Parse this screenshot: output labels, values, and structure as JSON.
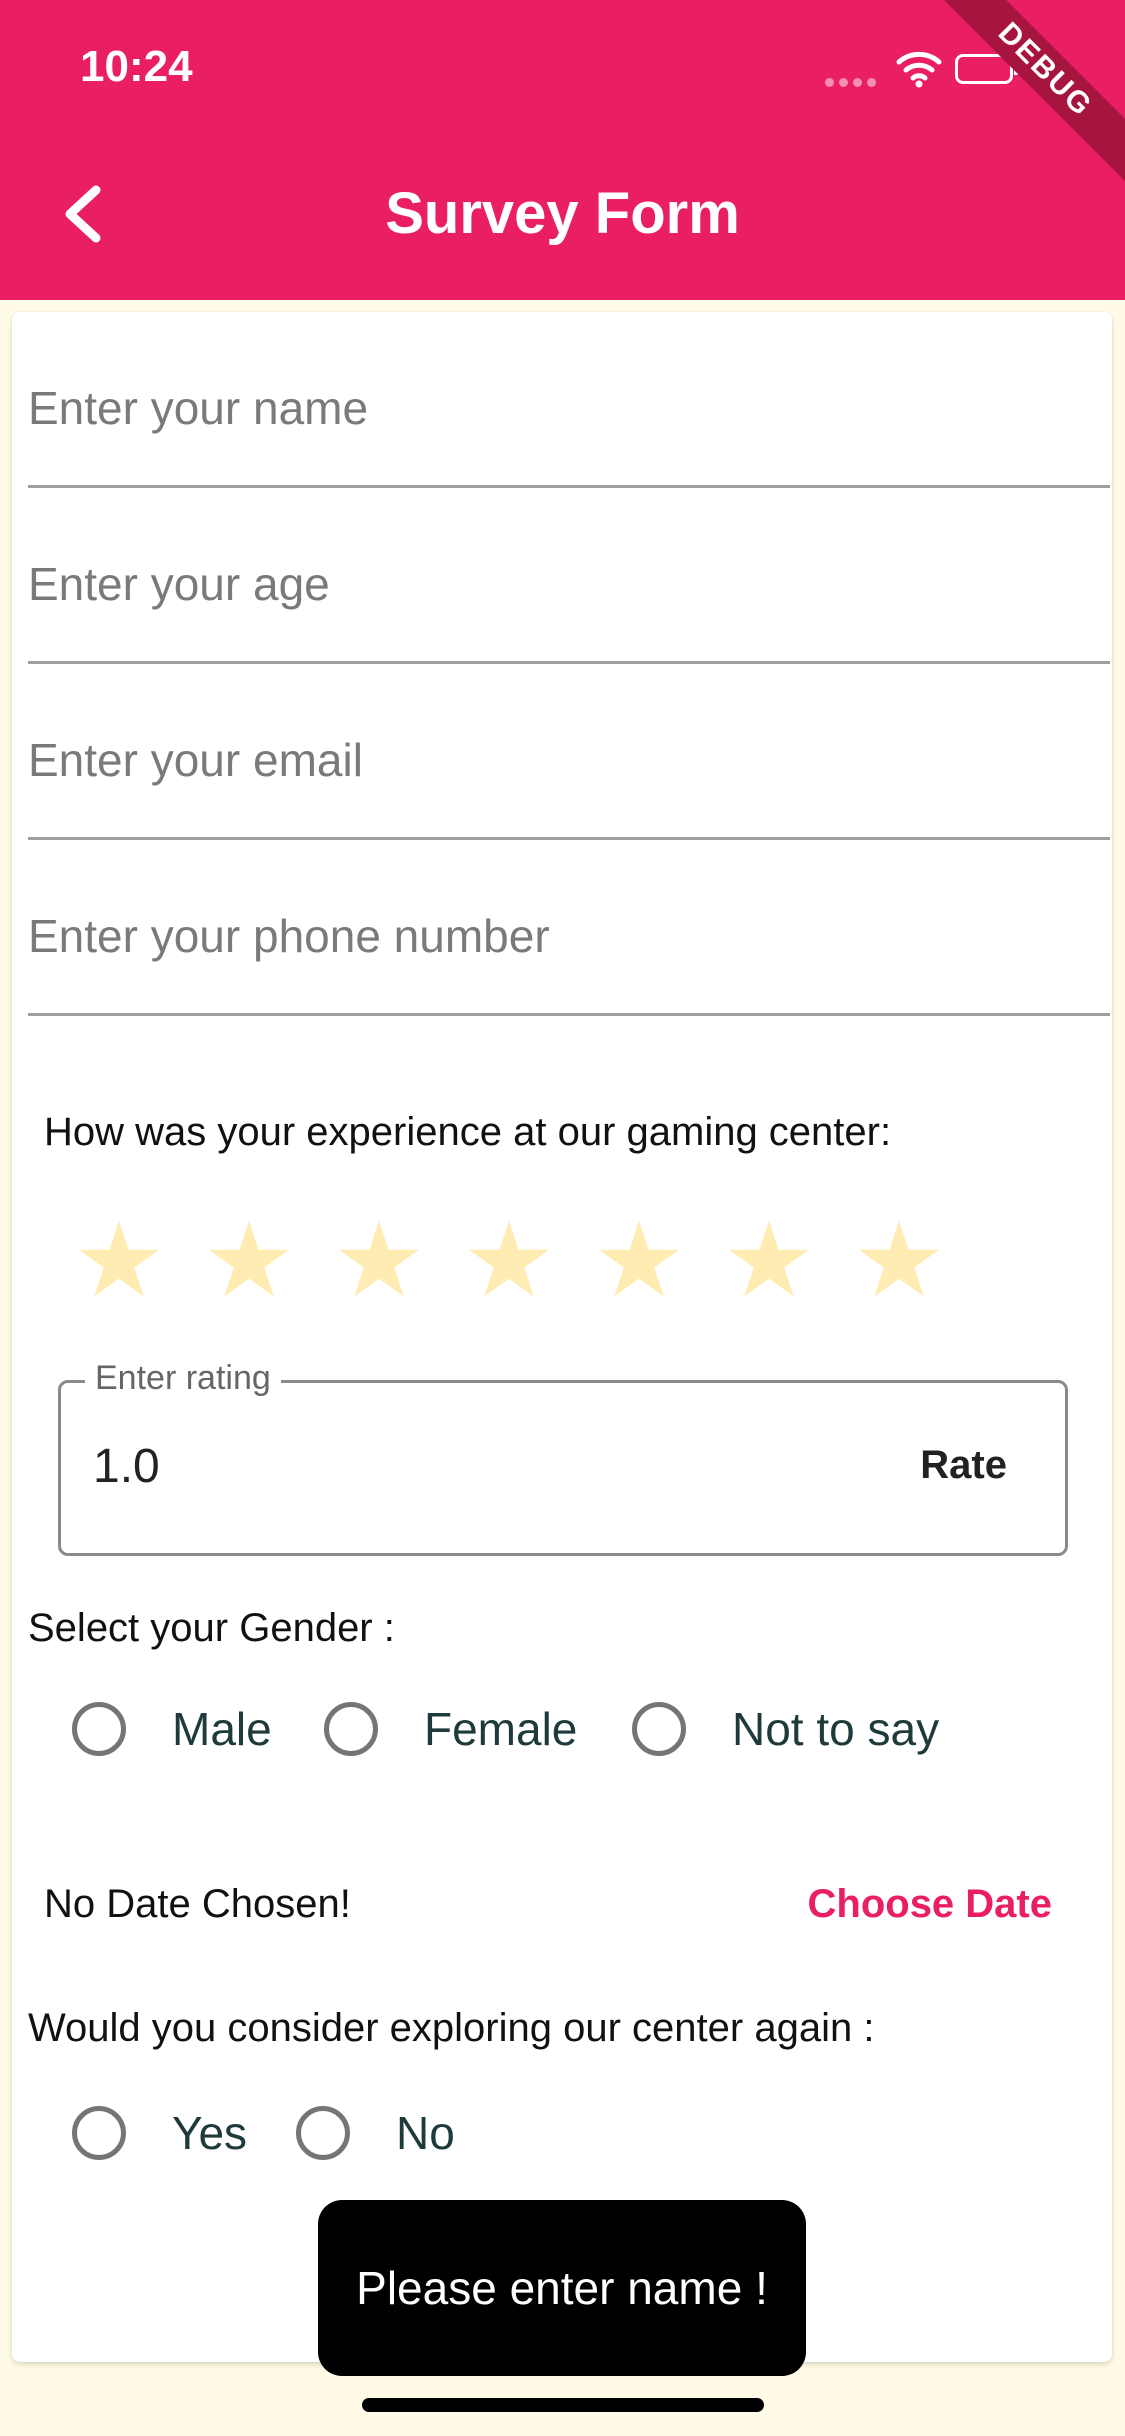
{
  "status_bar": {
    "time": "10:24",
    "debug_label": "DEBUG"
  },
  "appbar": {
    "title": "Survey Form",
    "back_icon": "chevron-left-icon"
  },
  "form": {
    "name_placeholder": "Enter your name",
    "age_placeholder": "Enter your age",
    "email_placeholder": "Enter your email",
    "phone_placeholder": "Enter your phone number",
    "experience_question": "How was your experience at our gaming center:",
    "stars": {
      "count": 7,
      "glyph": "★",
      "color": "#ffecb3"
    },
    "rating": {
      "label": "Enter rating",
      "value": "1.0",
      "button": "Rate"
    },
    "gender": {
      "question": "Select your Gender :",
      "options": [
        "Male",
        "Female",
        "Not to say"
      ]
    },
    "date": {
      "status": "No Date Chosen!",
      "button": "Choose Date"
    },
    "revisit": {
      "question": "Would you consider exploring our center again :",
      "options": [
        "Yes",
        "No"
      ]
    }
  },
  "toast": {
    "message": "Please enter name !"
  },
  "colors": {
    "primary": "#e91e63",
    "background": "#fffbe6",
    "star": "#ffecb3"
  }
}
